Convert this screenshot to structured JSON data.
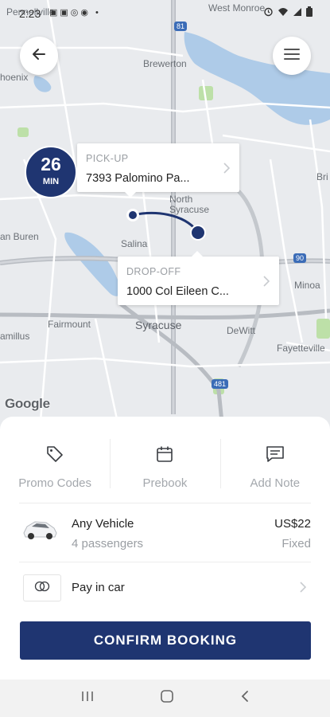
{
  "status_bar": {
    "time": "2:23"
  },
  "map": {
    "labels": {
      "pennellville": "Pennellville",
      "west_monroe": "West Monroe",
      "phoenix": "hoenix",
      "brewerton": "Brewerton",
      "north_syracuse": "North\nSyracuse",
      "van_buren": "an Buren",
      "salina": "Salina",
      "minoa": "Minoa",
      "syracuse": "Syracuse",
      "fairmount": "Fairmount",
      "dewitt": "DeWitt",
      "camillus": "amillus",
      "fayetteville": "Fayetteville",
      "bri": "Bri",
      "interstate_81_top": "81",
      "interstate_90": "90",
      "interstate_481": "481"
    },
    "google_logo": "Google"
  },
  "eta": {
    "value": "26",
    "unit": "MIN"
  },
  "pickup": {
    "label": "PICK-UP",
    "address": "7393 Palomino Pa..."
  },
  "dropoff": {
    "label": "DROP-OFF",
    "address": "1000 Col Eileen C..."
  },
  "actions": [
    {
      "label": "Promo Codes",
      "icon": "tag-icon"
    },
    {
      "label": "Prebook",
      "icon": "calendar-icon"
    },
    {
      "label": "Add Note",
      "icon": "note-icon"
    }
  ],
  "vehicle": {
    "name": "Any Vehicle",
    "passengers": "4 passengers",
    "price": "US$22",
    "price_type": "Fixed"
  },
  "payment": {
    "label": "Pay in car"
  },
  "confirm_label": "CONFIRM BOOKING",
  "colors": {
    "brand": "#1f3571",
    "map_water": "#aecbe8",
    "map_park": "#bde0a8"
  }
}
